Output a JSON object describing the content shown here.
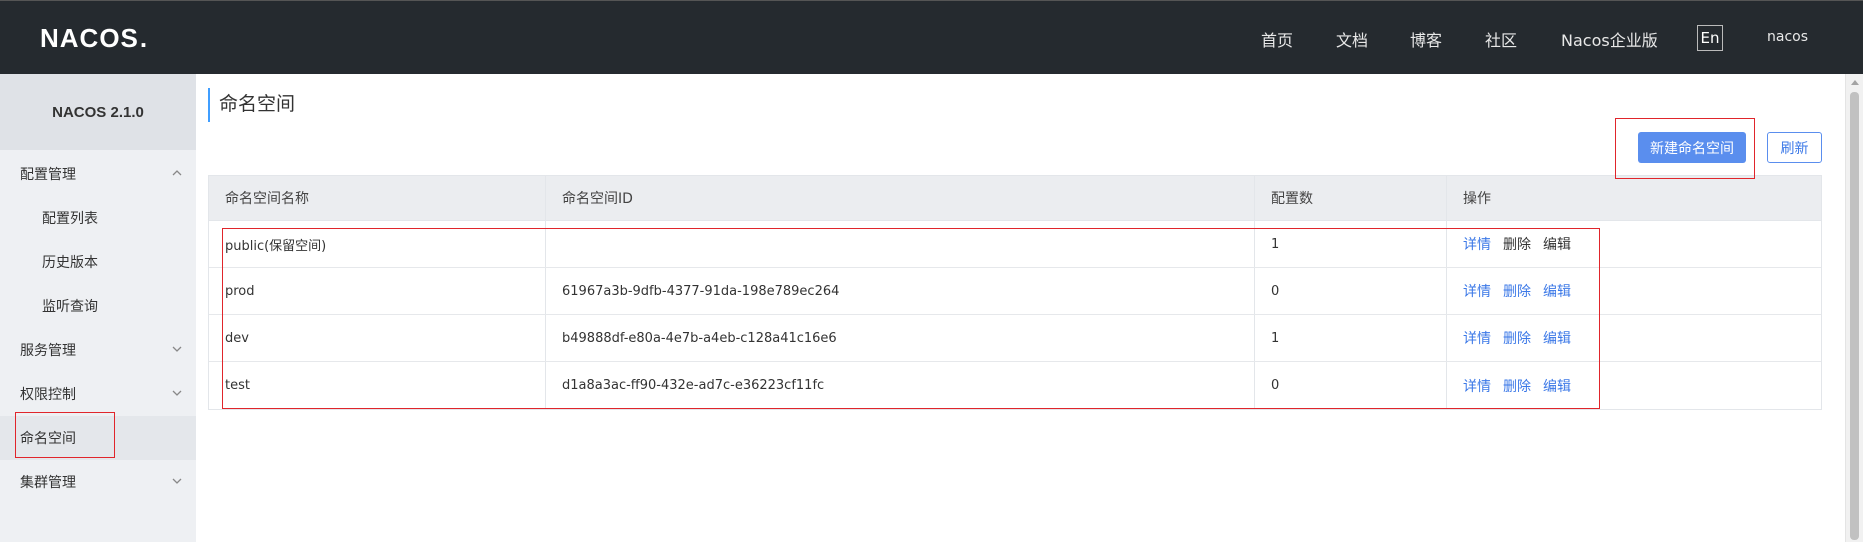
{
  "header": {
    "logo_text": "NACOS",
    "logo_dot": ".",
    "nav": [
      "首页",
      "文档",
      "博客",
      "社区",
      "Nacos企业版"
    ],
    "lang_button": "En",
    "user": "nacos"
  },
  "sidebar": {
    "version": "NACOS 2.1.0",
    "items": [
      {
        "label": "配置管理"
      },
      {
        "label": "配置列表"
      },
      {
        "label": "历史版本"
      },
      {
        "label": "监听查询"
      },
      {
        "label": "服务管理"
      },
      {
        "label": "权限控制"
      },
      {
        "label": "命名空间"
      },
      {
        "label": "集群管理"
      }
    ]
  },
  "main": {
    "title": "命名空间",
    "new_button": "新建命名空间",
    "refresh_button": "刷新"
  },
  "table": {
    "headers": [
      "命名空间名称",
      "命名空间ID",
      "配置数",
      "操作"
    ],
    "actions": [
      "详情",
      "删除",
      "编辑"
    ],
    "rows": [
      {
        "name": "public(保留空间)",
        "id": "",
        "count": "1"
      },
      {
        "name": "prod",
        "id": "61967a3b-9dfb-4377-91da-198e789ec264",
        "count": "0"
      },
      {
        "name": "dev",
        "id": "b49888df-e80a-4e7b-a4eb-c128a41c16e6",
        "count": "1"
      },
      {
        "name": "test",
        "id": "d1a8a3ac-ff90-432e-ad7c-e36223cf11fc",
        "count": "0"
      }
    ]
  },
  "colors": {
    "header_bg": "#252a2f",
    "primary": "#5a8eee",
    "link": "#3b78e7",
    "highlight_box": "#e0252b"
  }
}
